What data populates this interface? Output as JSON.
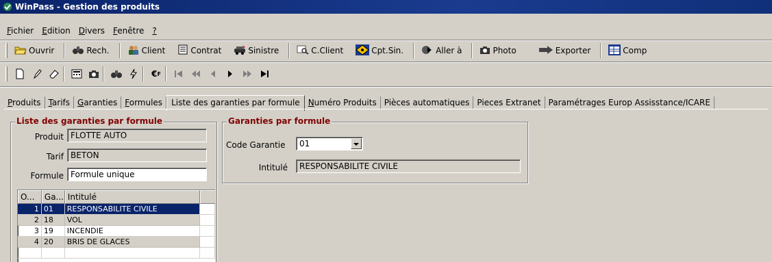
{
  "window": {
    "title": "WinPass - Gestion des produits"
  },
  "menu": [
    {
      "pre": "",
      "u": "F",
      "post": "ichier"
    },
    {
      "pre": "",
      "u": "E",
      "post": "dition"
    },
    {
      "pre": "",
      "u": "D",
      "post": "ivers"
    },
    {
      "pre": "",
      "u": "F",
      "post": "enêtre"
    },
    {
      "pre": "",
      "u": "?",
      "post": ""
    }
  ],
  "toolbar": {
    "ouvrir": "Ouvrir",
    "rech": "Rech.",
    "client": "Client",
    "contrat": "Contrat",
    "sinistre": "Sinistre",
    "cclient": "C.Client",
    "cptsin": "Cpt.Sin.",
    "aller": "Aller à",
    "photo": "Photo",
    "exporter": "Exporter",
    "comp": "Comp"
  },
  "tabs": [
    {
      "u": "P",
      "post": "roduits",
      "active": false
    },
    {
      "u": "T",
      "post": "arifs",
      "active": false
    },
    {
      "u": "G",
      "post": "aranties",
      "active": false
    },
    {
      "u": "F",
      "post": "ormules",
      "active": false
    },
    {
      "u": "",
      "post": "Liste des garanties par formule",
      "active": true
    },
    {
      "u": "N",
      "post": "uméro Produits",
      "active": false
    },
    {
      "u": "",
      "post": "Pièces automatiques",
      "active": false
    },
    {
      "u": "",
      "post": "Pieces  Extranet",
      "active": false
    },
    {
      "u": "",
      "post": "Paramétrages Europ Assisstance/ICARE",
      "active": false
    }
  ],
  "left_group": {
    "legend": "Liste des garanties par formule",
    "produit_label": "Produit",
    "produit_value": "FLOTTE AUTO",
    "tarif_label": "Tarif",
    "tarif_value": "BETON",
    "formule_label": "Formule",
    "formule_value": "Formule unique"
  },
  "grid": {
    "headers": [
      "O...",
      "Ga...",
      "Intitulé"
    ],
    "rows": [
      {
        "o": "1",
        "ga": "01",
        "intitule": "RESPONSABILITE CIVILE",
        "state": "sel"
      },
      {
        "o": "2",
        "ga": "18",
        "intitule": "VOL",
        "state": "alt"
      },
      {
        "o": "3",
        "ga": "19",
        "intitule": "INCENDIE",
        "state": ""
      },
      {
        "o": "4",
        "ga": "20",
        "intitule": "BRIS DE GLACES",
        "state": "alt"
      }
    ]
  },
  "right_group": {
    "legend": "Garanties par formule",
    "code_label": "Code Garantie",
    "code_value": "01",
    "intitule_label": "Intitulé",
    "intitule_value": "RESPONSABILITE CIVILE"
  },
  "colors": {
    "title_bar": "#0a246a",
    "legend": "#800000",
    "face": "#d4d0c8",
    "selection": "#0a246a"
  }
}
